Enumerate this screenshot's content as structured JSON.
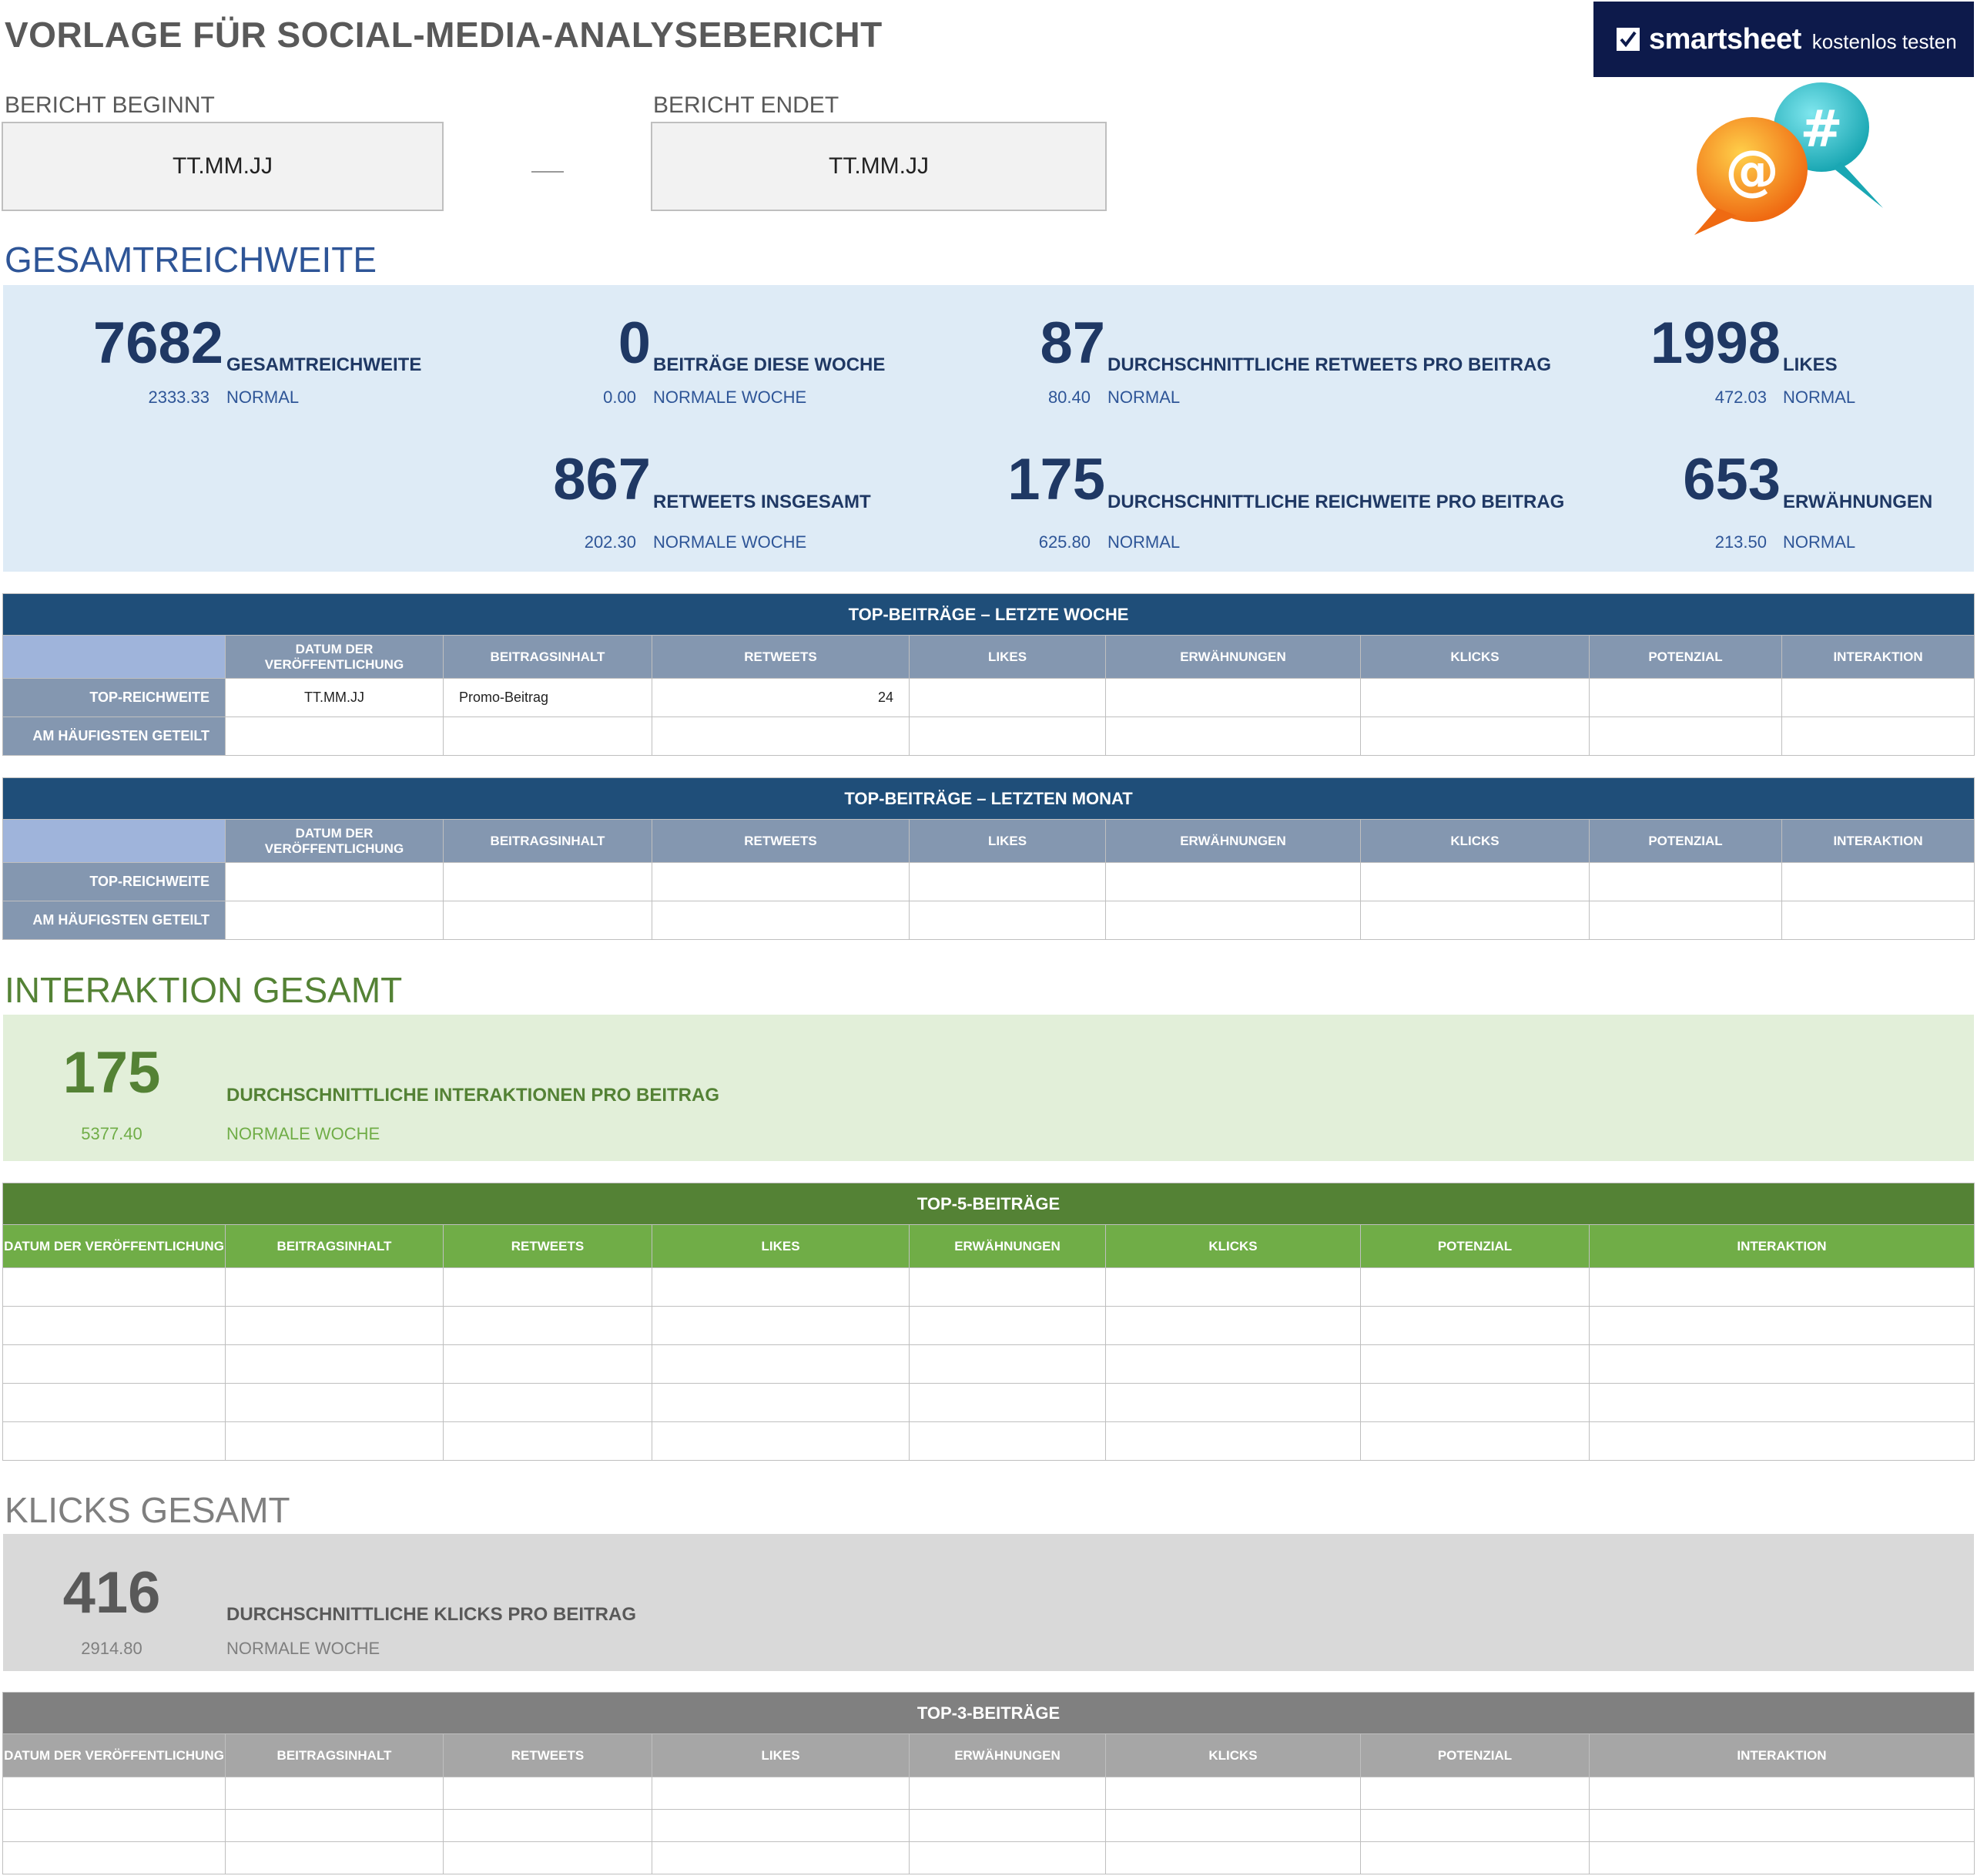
{
  "header": {
    "title": "VORLAGE FÜR SOCIAL-MEDIA-ANALYSEBERICHT",
    "logo": {
      "word": "smartsheet",
      "sub": "kostenlos testen",
      "background": "#0d1a4b"
    },
    "illustration_icons": [
      "at-bubble-icon",
      "hashtag-bubble-icon"
    ]
  },
  "report": {
    "start_label": "BERICHT BEGINNT",
    "start_value": "TT.MM.JJ",
    "end_label": "BERICHT ENDET",
    "end_value": "TT.MM.JJ"
  },
  "reach": {
    "heading": "GESAMTREICHWEITE",
    "metrics": [
      {
        "value": "7682",
        "label": "GESAMTREICHWEITE",
        "norm": "2333.33",
        "norm_label": "NORMAL"
      },
      {
        "value": "0",
        "label": "BEITRÄGE DIESE WOCHE",
        "norm": "0.00",
        "norm_label": "NORMALE WOCHE"
      },
      {
        "value": "87",
        "label": "DURCHSCHNITTLICHE RETWEETS PRO BEITRAG",
        "norm": "80.40",
        "norm_label": "NORMAL"
      },
      {
        "value": "1998",
        "label": "LIKES",
        "norm": "472.03",
        "norm_label": "NORMAL"
      },
      {
        "value": "867",
        "label": "RETWEETS INSGESAMT",
        "norm": "202.30",
        "norm_label": "NORMALE WOCHE"
      },
      {
        "value": "175",
        "label": "DURCHSCHNITTLICHE REICHWEITE PRO BEITRAG",
        "norm": "625.80",
        "norm_label": "NORMAL"
      },
      {
        "value": "653",
        "label": "ERWÄHNUNGEN",
        "norm": "213.50",
        "norm_label": "NORMAL"
      }
    ]
  },
  "columns": {
    "date": "DATUM DER VERÖFFENTLICHUNG",
    "content": "BEITRAGSINHALT",
    "retweets": "RETWEETS",
    "likes": "LIKES",
    "mentions": "ERWÄHNUNGEN",
    "clicks": "KLICKS",
    "potential": "POTENZIAL",
    "interaction": "INTERAKTION"
  },
  "row_labels": {
    "top_reach": "TOP-REICHWEITE",
    "most_shared": "AM HÄUFIGSTEN GETEILT"
  },
  "week_table": {
    "title": "TOP-BEITRÄGE – LETZTE WOCHE",
    "rows": [
      [
        "TT.MM.JJ",
        "Promo-Beitrag",
        "24",
        "",
        "",
        "",
        "",
        ""
      ],
      [
        "",
        "",
        "",
        "",
        "",
        "",
        "",
        ""
      ]
    ]
  },
  "month_table": {
    "title": "TOP-BEITRÄGE – LETZTEN MONAT",
    "rows": [
      [
        "",
        "",
        "",
        "",
        "",
        "",
        "",
        ""
      ],
      [
        "",
        "",
        "",
        "",
        "",
        "",
        "",
        ""
      ]
    ]
  },
  "interaction": {
    "heading": "INTERAKTION GESAMT",
    "value": "175",
    "label": "DURCHSCHNITTLICHE INTERAKTIONEN PRO BEITRAG",
    "norm": "5377.40",
    "norm_label": "NORMALE WOCHE"
  },
  "top5_table": {
    "title": "TOP-5-BEITRÄGE",
    "row_count": 5
  },
  "clicks": {
    "heading": "KLICKS GESAMT",
    "value": "416",
    "label": "DURCHSCHNITTLICHE KLICKS PRO BEITRAG",
    "norm": "2914.80",
    "norm_label": "NORMALE WOCHE"
  },
  "top3_table": {
    "title": "TOP-3-BEITRÄGE",
    "row_count": 3
  },
  "colors": {
    "blue_panel": "#deebf6",
    "blue_title": "#1f4e79",
    "blue_header": "#8497b0",
    "green_panel": "#e2efd9",
    "green_title": "#548235",
    "green_header": "#70ad47",
    "gray_panel": "#d9d9d9",
    "gray_title": "#808080",
    "gray_header": "#a6a6a6"
  }
}
